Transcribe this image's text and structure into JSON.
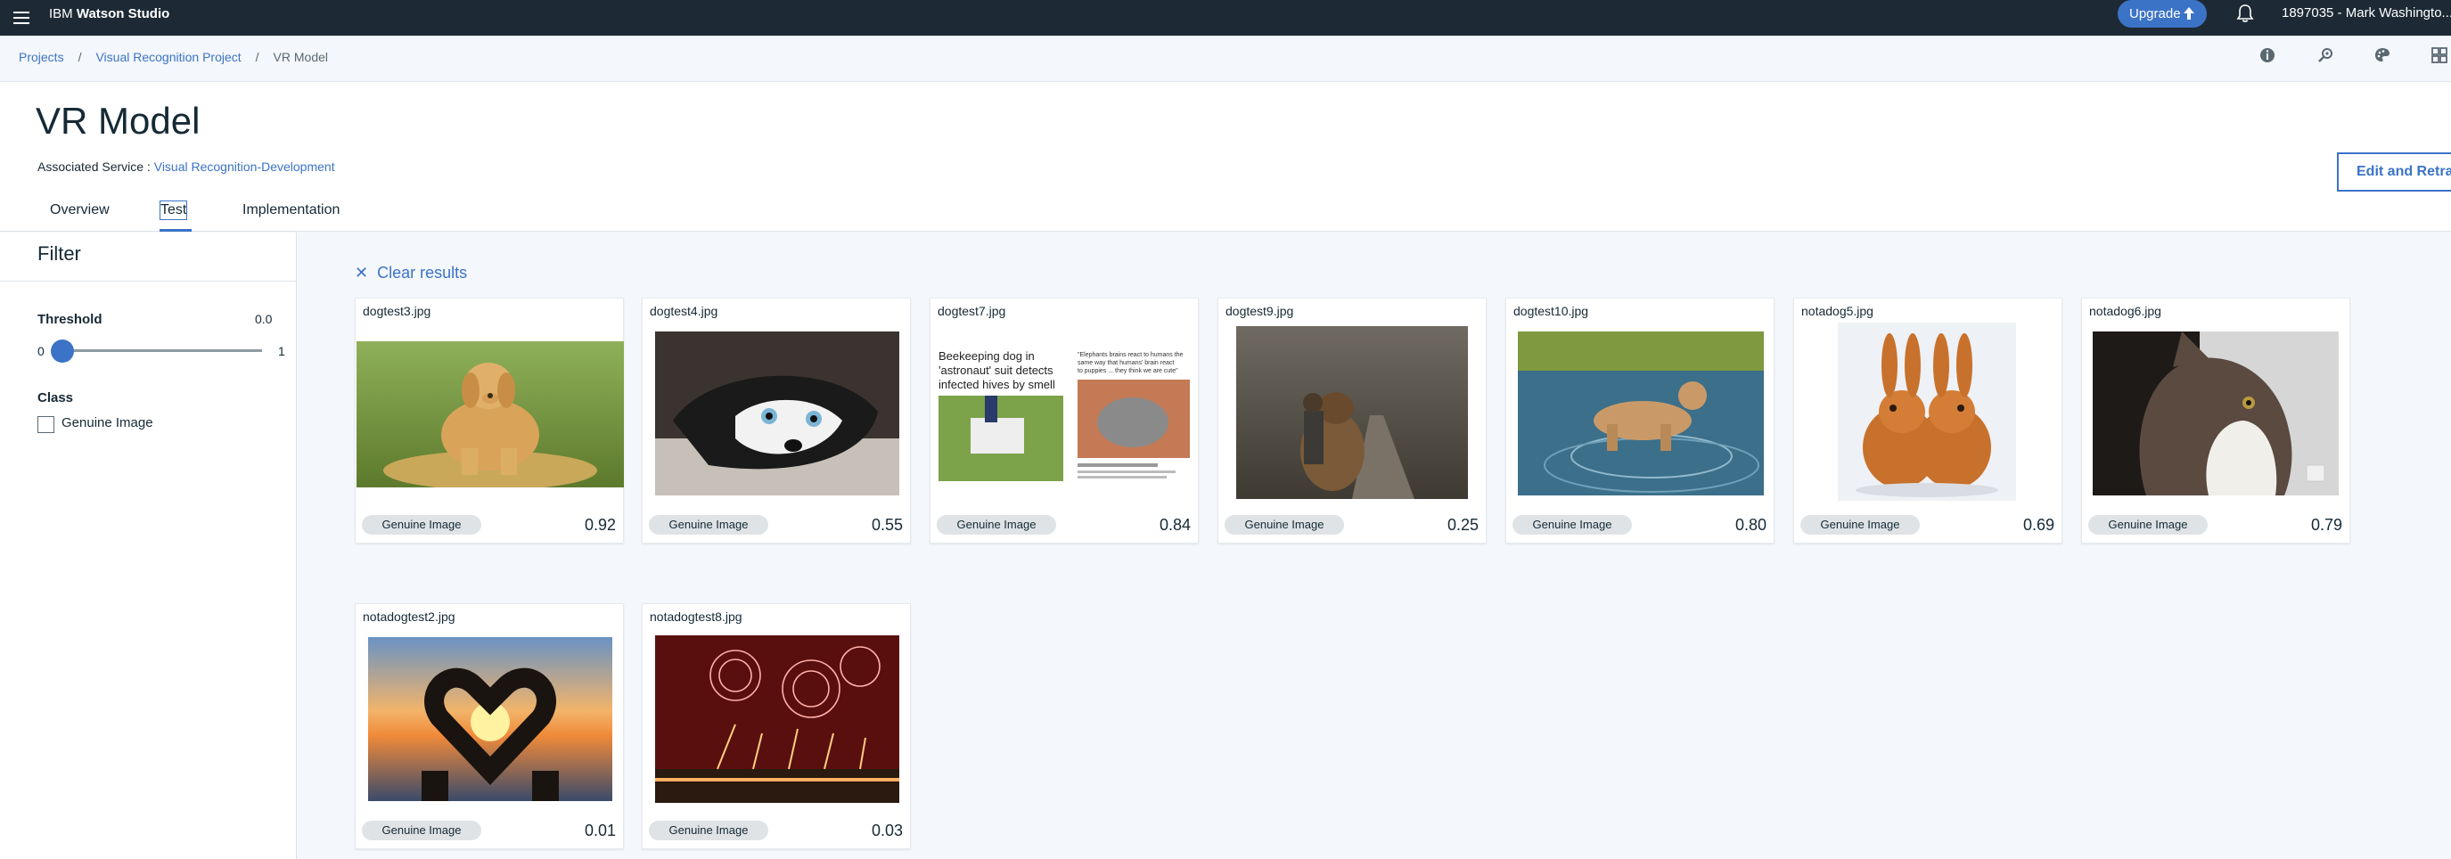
{
  "topbar": {
    "brand_light": "IBM",
    "brand_bold": "Watson Studio",
    "upgrade_label": "Upgrade",
    "account": "1897035 - Mark Washingto..."
  },
  "breadcrumb": {
    "projects": "Projects",
    "project": "Visual Recognition Project",
    "current": "VR Model",
    "separator": "/"
  },
  "header": {
    "title": "VR Model",
    "assoc_label": "Associated Service :",
    "assoc_link": "Visual Recognition-Development",
    "edit_button": "Edit and Retrain"
  },
  "tabs": [
    {
      "label": "Overview"
    },
    {
      "label": "Test"
    },
    {
      "label": "Implementation"
    }
  ],
  "filter": {
    "title": "Filter",
    "threshold_label": "Threshold",
    "threshold_value": "0.0",
    "slider_min": "0",
    "slider_max": "1",
    "class_label": "Class",
    "class_option": "Genuine Image"
  },
  "clear_results": "Clear results",
  "results": [
    {
      "file": "dogtest3.jpg",
      "class": "Genuine Image",
      "score": "0.92",
      "thumb": "golden-retriever-photo"
    },
    {
      "file": "dogtest4.jpg",
      "class": "Genuine Image",
      "score": "0.55",
      "thumb": "husky-photo"
    },
    {
      "file": "dogtest7.jpg",
      "class": "Genuine Image",
      "score": "0.84",
      "thumb": "news-article-photo",
      "article_left": [
        "Beekeeping dog in",
        "'astronaut' suit detects",
        "infected hives by smell"
      ],
      "article_right": [
        "\"Elephants brains react to humans the",
        "same way that humans' brain react",
        "to puppies ... they think we are cute\""
      ]
    },
    {
      "file": "dogtest9.jpg",
      "class": "Genuine Image",
      "score": "0.25",
      "thumb": "child-and-dog-photo"
    },
    {
      "file": "dogtest10.jpg",
      "class": "Genuine Image",
      "score": "0.80",
      "thumb": "dog-in-water-photo"
    },
    {
      "file": "notadog5.jpg",
      "class": "Genuine Image",
      "score": "0.69",
      "thumb": "rabbits-photo"
    },
    {
      "file": "notadog6.jpg",
      "class": "Genuine Image",
      "score": "0.79",
      "thumb": "cat-photo"
    },
    {
      "file": "notadogtest2.jpg",
      "class": "Genuine Image",
      "score": "0.01",
      "thumb": "heart-hands-sunset-photo"
    },
    {
      "file": "notadogtest8.jpg",
      "class": "Genuine Image",
      "score": "0.03",
      "thumb": "fireworks-photo"
    }
  ],
  "colors": {
    "topbar": "#1d2a35",
    "accent": "#3b73c7",
    "page_bg": "#f4f7fb",
    "tag_bg": "#dfe3e6"
  }
}
